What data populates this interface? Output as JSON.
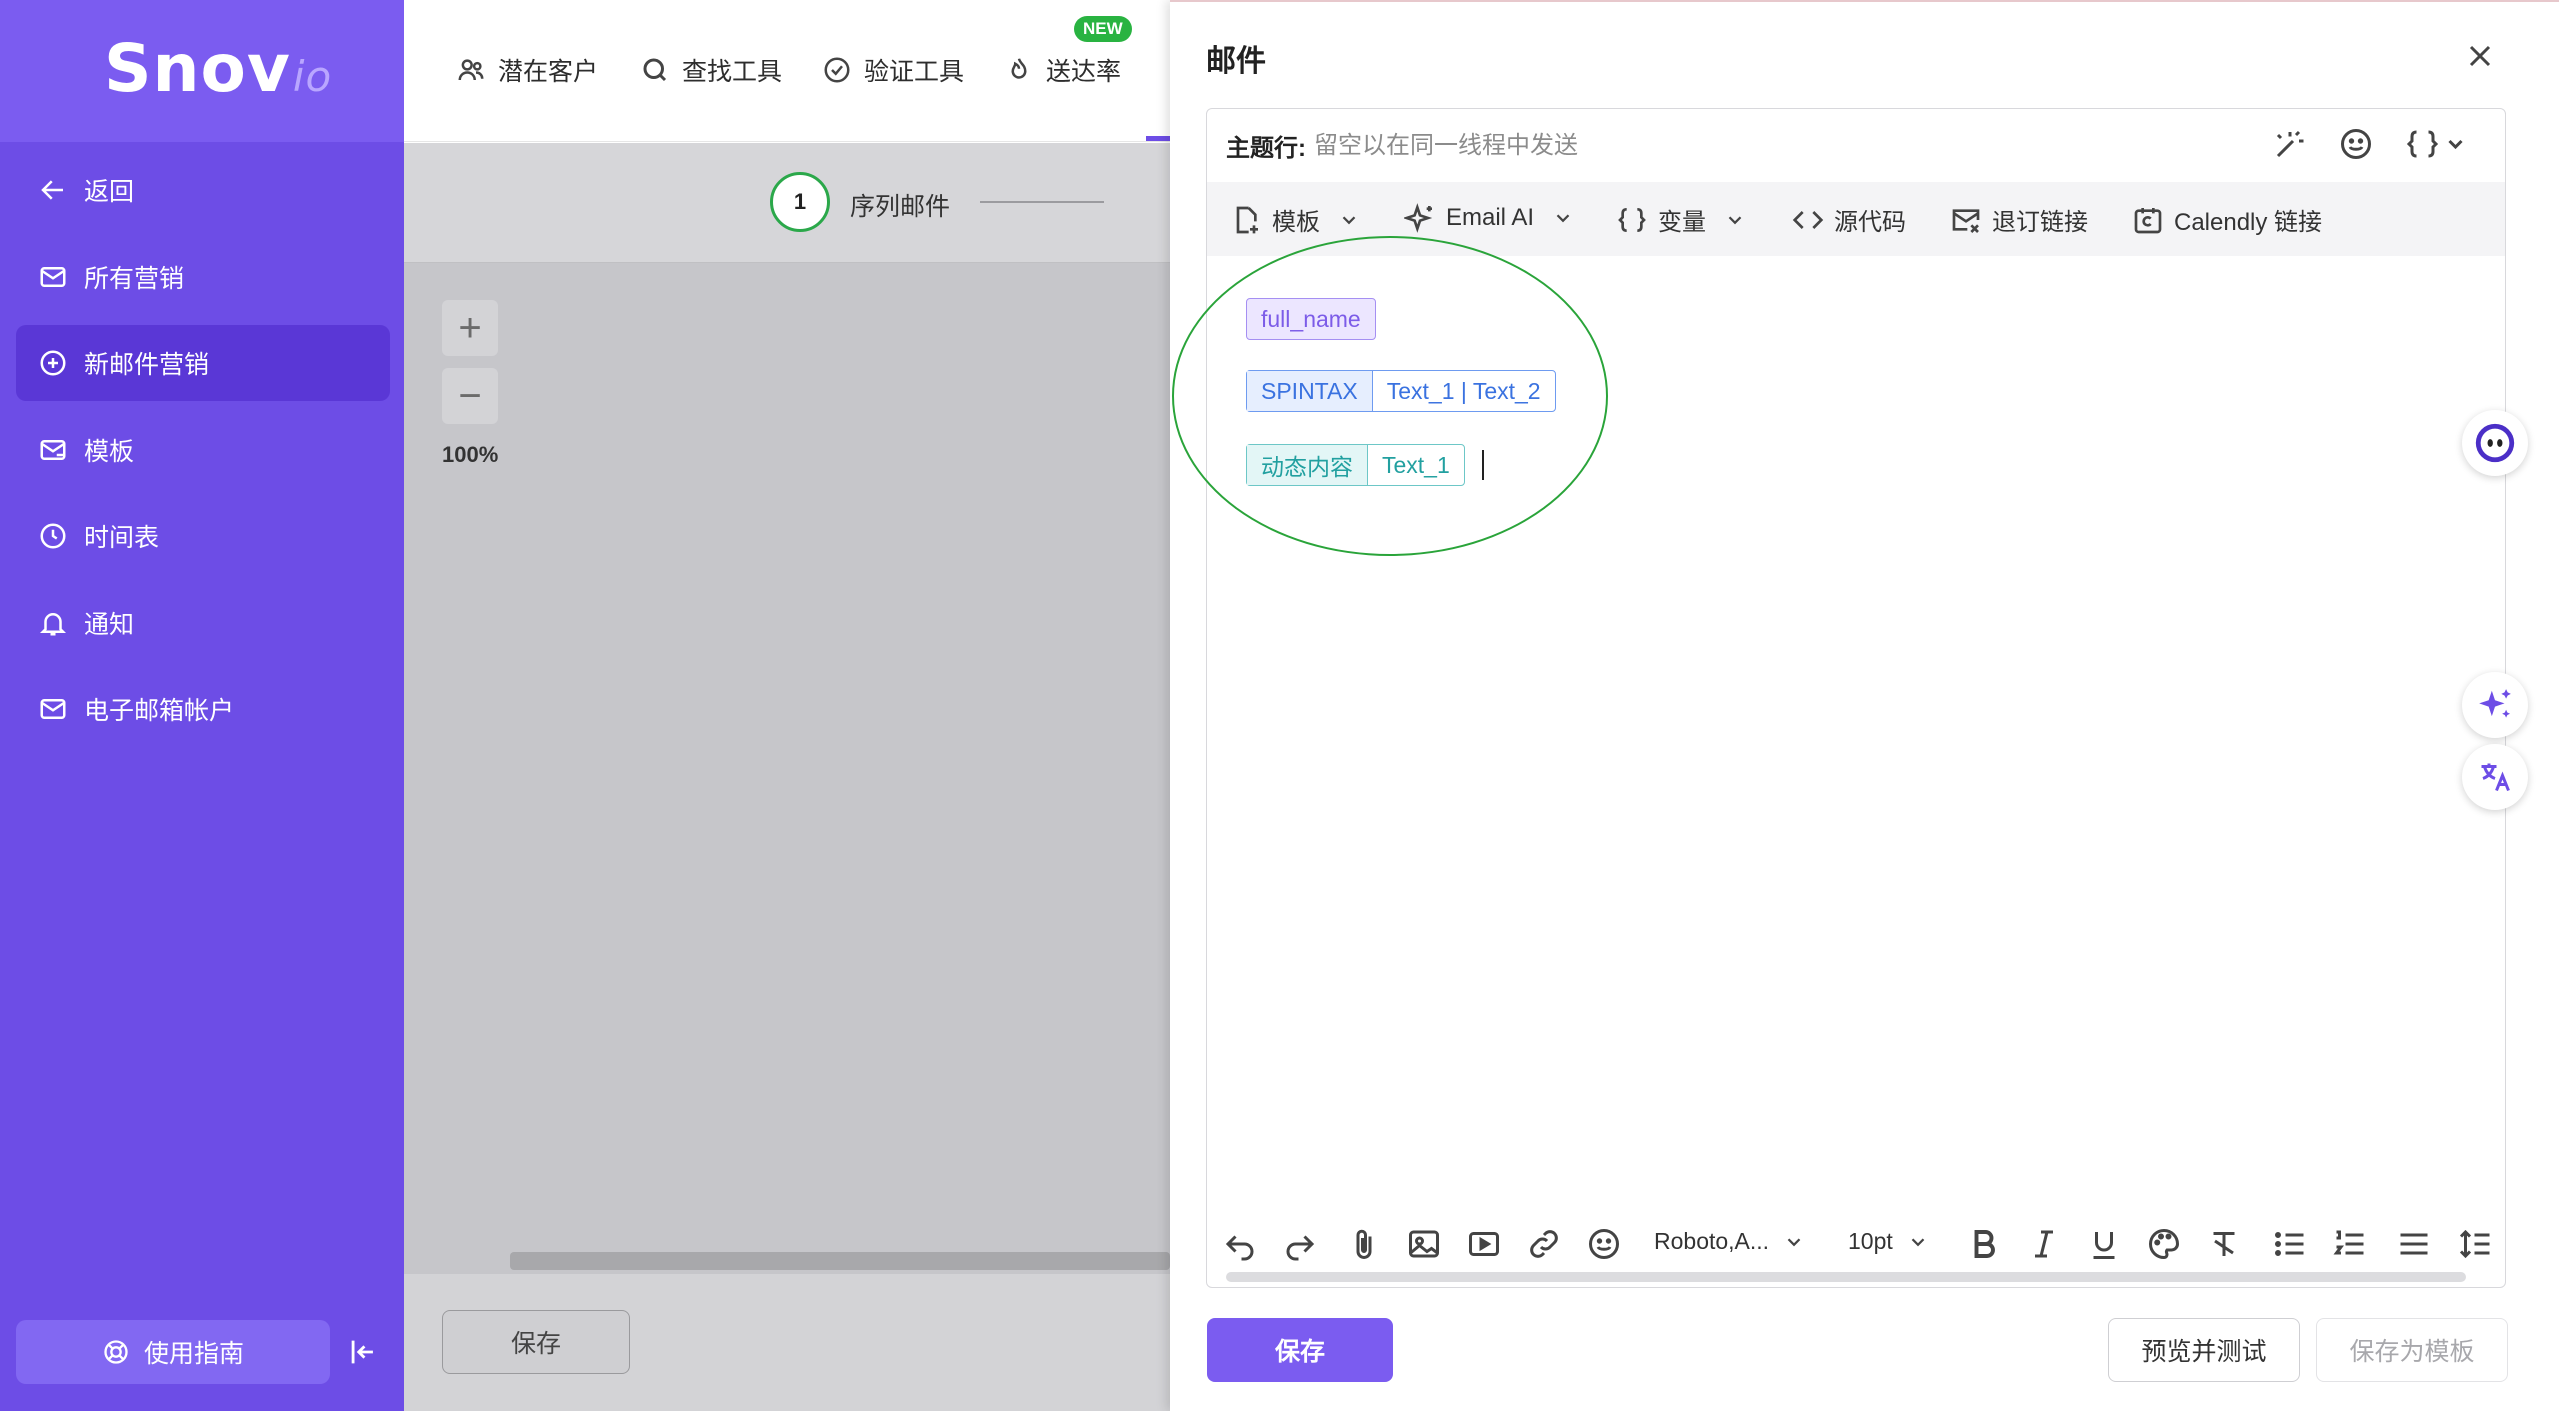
{
  "sidebar": {
    "logo_main": "Snov",
    "logo_sub": "io",
    "items": [
      {
        "label": "返回",
        "icon": "arrow-left-icon"
      },
      {
        "label": "所有营销",
        "icon": "mail-icon"
      },
      {
        "label": "新邮件营销",
        "icon": "plus-circle-icon",
        "active": true
      },
      {
        "label": "模板",
        "icon": "mail-template-icon"
      },
      {
        "label": "时间表",
        "icon": "clock-icon"
      },
      {
        "label": "通知",
        "icon": "bell-icon"
      },
      {
        "label": "电子邮箱帐户",
        "icon": "mail-account-icon"
      }
    ],
    "guide_label": "使用指南"
  },
  "topnav": {
    "items": [
      {
        "label": "潜在客户",
        "icon": "users-icon"
      },
      {
        "label": "查找工具",
        "icon": "search-icon"
      },
      {
        "label": "验证工具",
        "icon": "check-circle-icon"
      },
      {
        "label": "送达率",
        "icon": "flame-icon"
      }
    ],
    "badge": "NEW"
  },
  "canvas": {
    "step_number": "1",
    "step_label": "序列邮件",
    "zoom_in": "+",
    "zoom_out": "−",
    "zoom_level": "100%",
    "save_label": "保存"
  },
  "email_panel": {
    "title": "邮件",
    "subject_label": "主题行:",
    "subject_placeholder": "留空以在同一线程中发送",
    "toolbar": {
      "template": "模板",
      "email_ai": "Email AI",
      "variables": "变量",
      "source": "源代码",
      "unsubscribe": "退订链接",
      "calendly": "Calendly 链接"
    },
    "tags": {
      "var_name": "full_name",
      "spintax_label": "SPINTAX",
      "spintax_value": "Text_1 | Text_2",
      "dynamic_label": "动态内容",
      "dynamic_value": "Text_1"
    },
    "format_bar": {
      "font": "Roboto,A...",
      "size": "10pt"
    },
    "buttons": {
      "save": "保存",
      "preview": "预览并测试",
      "save_template": "保存为模板"
    }
  },
  "colors": {
    "sidebar": "#6d4de6",
    "accent": "#7b5cf0",
    "annotation": "#2aa43a"
  }
}
